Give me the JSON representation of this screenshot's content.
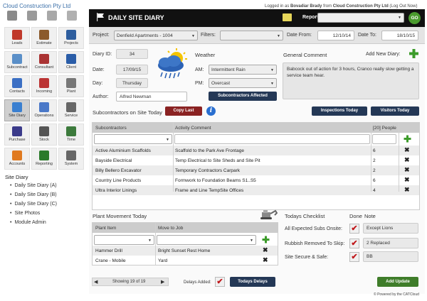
{
  "company": "Cloud Construction Pty Ltd",
  "login": {
    "prefix": "Logged in as",
    "user": "Bovadiar Brady",
    "from": "from",
    "org": "Cloud Construction Pty Ltd",
    "logout": "(Log Out Now)"
  },
  "nav_tiles": [
    {
      "label": "Leads",
      "icon": "house-icon",
      "color": "#c0392b"
    },
    {
      "label": "Estimate",
      "icon": "gavel-icon",
      "color": "#8b5a2b"
    },
    {
      "label": "Projects",
      "icon": "clipboard-icon",
      "color": "#2e5e9e"
    },
    {
      "label": "Subcontract",
      "icon": "contract-icon",
      "color": "#5a8fc8"
    },
    {
      "label": "Consultant",
      "icon": "consultant-icon",
      "color": "#a33"
    },
    {
      "label": "Client",
      "icon": "client-icon",
      "color": "#2a5da8"
    },
    {
      "label": "Contacts",
      "icon": "contacts-icon",
      "color": "#3b6fc4"
    },
    {
      "label": "Incoming",
      "icon": "inbox-icon",
      "color": "#b33"
    },
    {
      "label": "Plant",
      "icon": "excavator-icon",
      "color": "#777"
    },
    {
      "label": "Site Diary",
      "icon": "diary-icon",
      "color": "#3a7fd0"
    },
    {
      "label": "Operations",
      "icon": "operations-icon",
      "color": "#4a78c8"
    },
    {
      "label": "Service",
      "icon": "service-icon",
      "color": "#666"
    },
    {
      "label": "Purchase",
      "icon": "cart-icon",
      "color": "#3a3a8a"
    },
    {
      "label": "Stock",
      "icon": "stock-icon",
      "color": "#555"
    },
    {
      "label": "Time",
      "icon": "hourglass-icon",
      "color": "#3c7a3c"
    },
    {
      "label": "Accounts",
      "icon": "accounts-icon",
      "color": "#e07a20"
    },
    {
      "label": "Reporting",
      "icon": "chart-icon",
      "color": "#2a7a2a"
    },
    {
      "label": "System",
      "icon": "system-icon",
      "color": "#666"
    }
  ],
  "sidebar": {
    "title": "Site Diary",
    "links": [
      "Daily Site Diary (A)",
      "Daily Site Diary (B)",
      "Daily Site Diary (C)",
      "Site Photos",
      "Module Admin"
    ]
  },
  "header": {
    "title": "DAILY SITE DIARY",
    "reports_label": "Reports:",
    "go": "GO"
  },
  "filters": {
    "project_label": "Project:",
    "project_value": "Denfield Apartments - 1004",
    "filters_label": "Filters:",
    "filters_value": "",
    "date_from_label": "Date From:",
    "date_from": "12/10/14",
    "date_to_label": "Date To:",
    "date_to": "18/10/15"
  },
  "diary": {
    "id_label": "Diary ID:",
    "id": "34",
    "date_label": "Date:",
    "date": "17/09/15",
    "day_label": "Day:",
    "day": "Thursday",
    "author_label": "Author:",
    "author": "Alfred Newman"
  },
  "weather": {
    "title": "Weather",
    "am_label": "AM:",
    "am": "Intermittent Rain",
    "pm_label": "PM:",
    "pm": "Overcast",
    "subs_affected": "Subcontractors Affected"
  },
  "comment": {
    "title": "General Comment",
    "new_diary": "Add New Diary:",
    "text": "Babcock out of action for 3 hours, Cranco really slow getting a service team hear."
  },
  "subs_section": {
    "title": "Subcontractors on Site Today",
    "copy_last": "Copy Last",
    "inspections": "Inspections Today",
    "visitors": "Visitors Today",
    "col_sub": "Subcontractors",
    "col_activity": "Activity Comment",
    "col_people": "[20] People",
    "rows": [
      {
        "sub": "Active Aluminium Scaffolds",
        "activity": "Scaffold to the Park Ave Frontage",
        "people": "6"
      },
      {
        "sub": "Bayside Electrical",
        "activity": "Temp Electrical to Site Sheds and Site Pit",
        "people": "2"
      },
      {
        "sub": "Billy Bellero Excavator",
        "activity": "Temporary Contractors Carpark",
        "people": "2"
      },
      {
        "sub": "Country Line Products",
        "activity": "Formwork to Foundation Beams S1..S5",
        "people": "6"
      },
      {
        "sub": "Ultra Interior Linings",
        "activity": "Frame and Line TempSite Offices",
        "people": "4"
      }
    ]
  },
  "plant": {
    "title": "Plant Movement Today",
    "col_item": "Plant Item",
    "col_move": "Move to Job",
    "rows": [
      {
        "item": "Hammer Drill",
        "move": "Bright Sunset Rest Home"
      },
      {
        "item": "Crane - Mobile",
        "move": "Yard"
      }
    ],
    "paging": "Showing 19 of 19",
    "delays_label": "Delays Added:",
    "delays_btn": "Todays Delays"
  },
  "checklist": {
    "title": "Todays Checklist",
    "done": "Done",
    "note": "Note",
    "items": [
      {
        "label": "All Expected Subs Onsite:",
        "note": "Except Lions"
      },
      {
        "label": "Rubbish Removed To Skip:",
        "note": "2 Replaced"
      },
      {
        "label": "Site Secure & Safe:",
        "note": "BB"
      }
    ],
    "add_update": "Add Update"
  },
  "footer": "© Powered by the CATCloud"
}
